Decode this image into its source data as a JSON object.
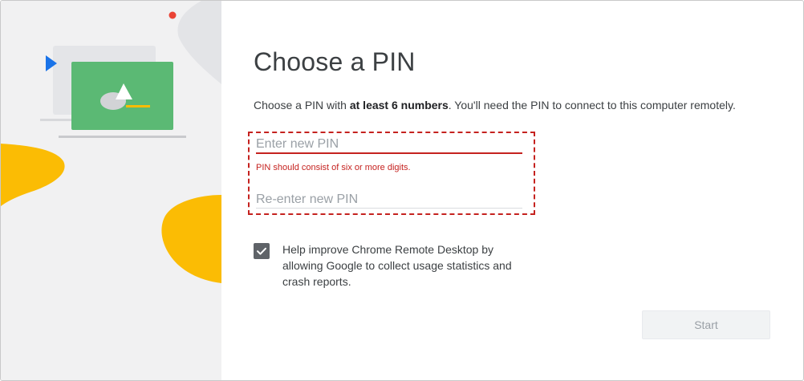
{
  "dialog": {
    "title": "Choose a PIN",
    "description": {
      "before": "Choose a PIN with ",
      "bold": "at least 6 numbers",
      "after": ". You'll need the PIN to connect to this computer remotely."
    },
    "pin_field": {
      "placeholder": "Enter new PIN",
      "value": ""
    },
    "pin_error": "PIN should consist of six or more digits.",
    "confirm_field": {
      "placeholder": "Re-enter new PIN",
      "value": ""
    },
    "checkbox": {
      "checked": true,
      "label": "Help improve Chrome Remote Desktop by allowing Google to collect usage statistics and crash reports."
    },
    "start_button": {
      "label": "Start",
      "enabled": false
    }
  },
  "colors": {
    "error": "#c5221f",
    "screen_green": "#5bb974",
    "accent_yellow": "#fbbc04",
    "accent_blue": "#1a73e8",
    "accent_red": "#ea4335"
  },
  "icons": [
    "computer-illustration",
    "check-icon"
  ]
}
